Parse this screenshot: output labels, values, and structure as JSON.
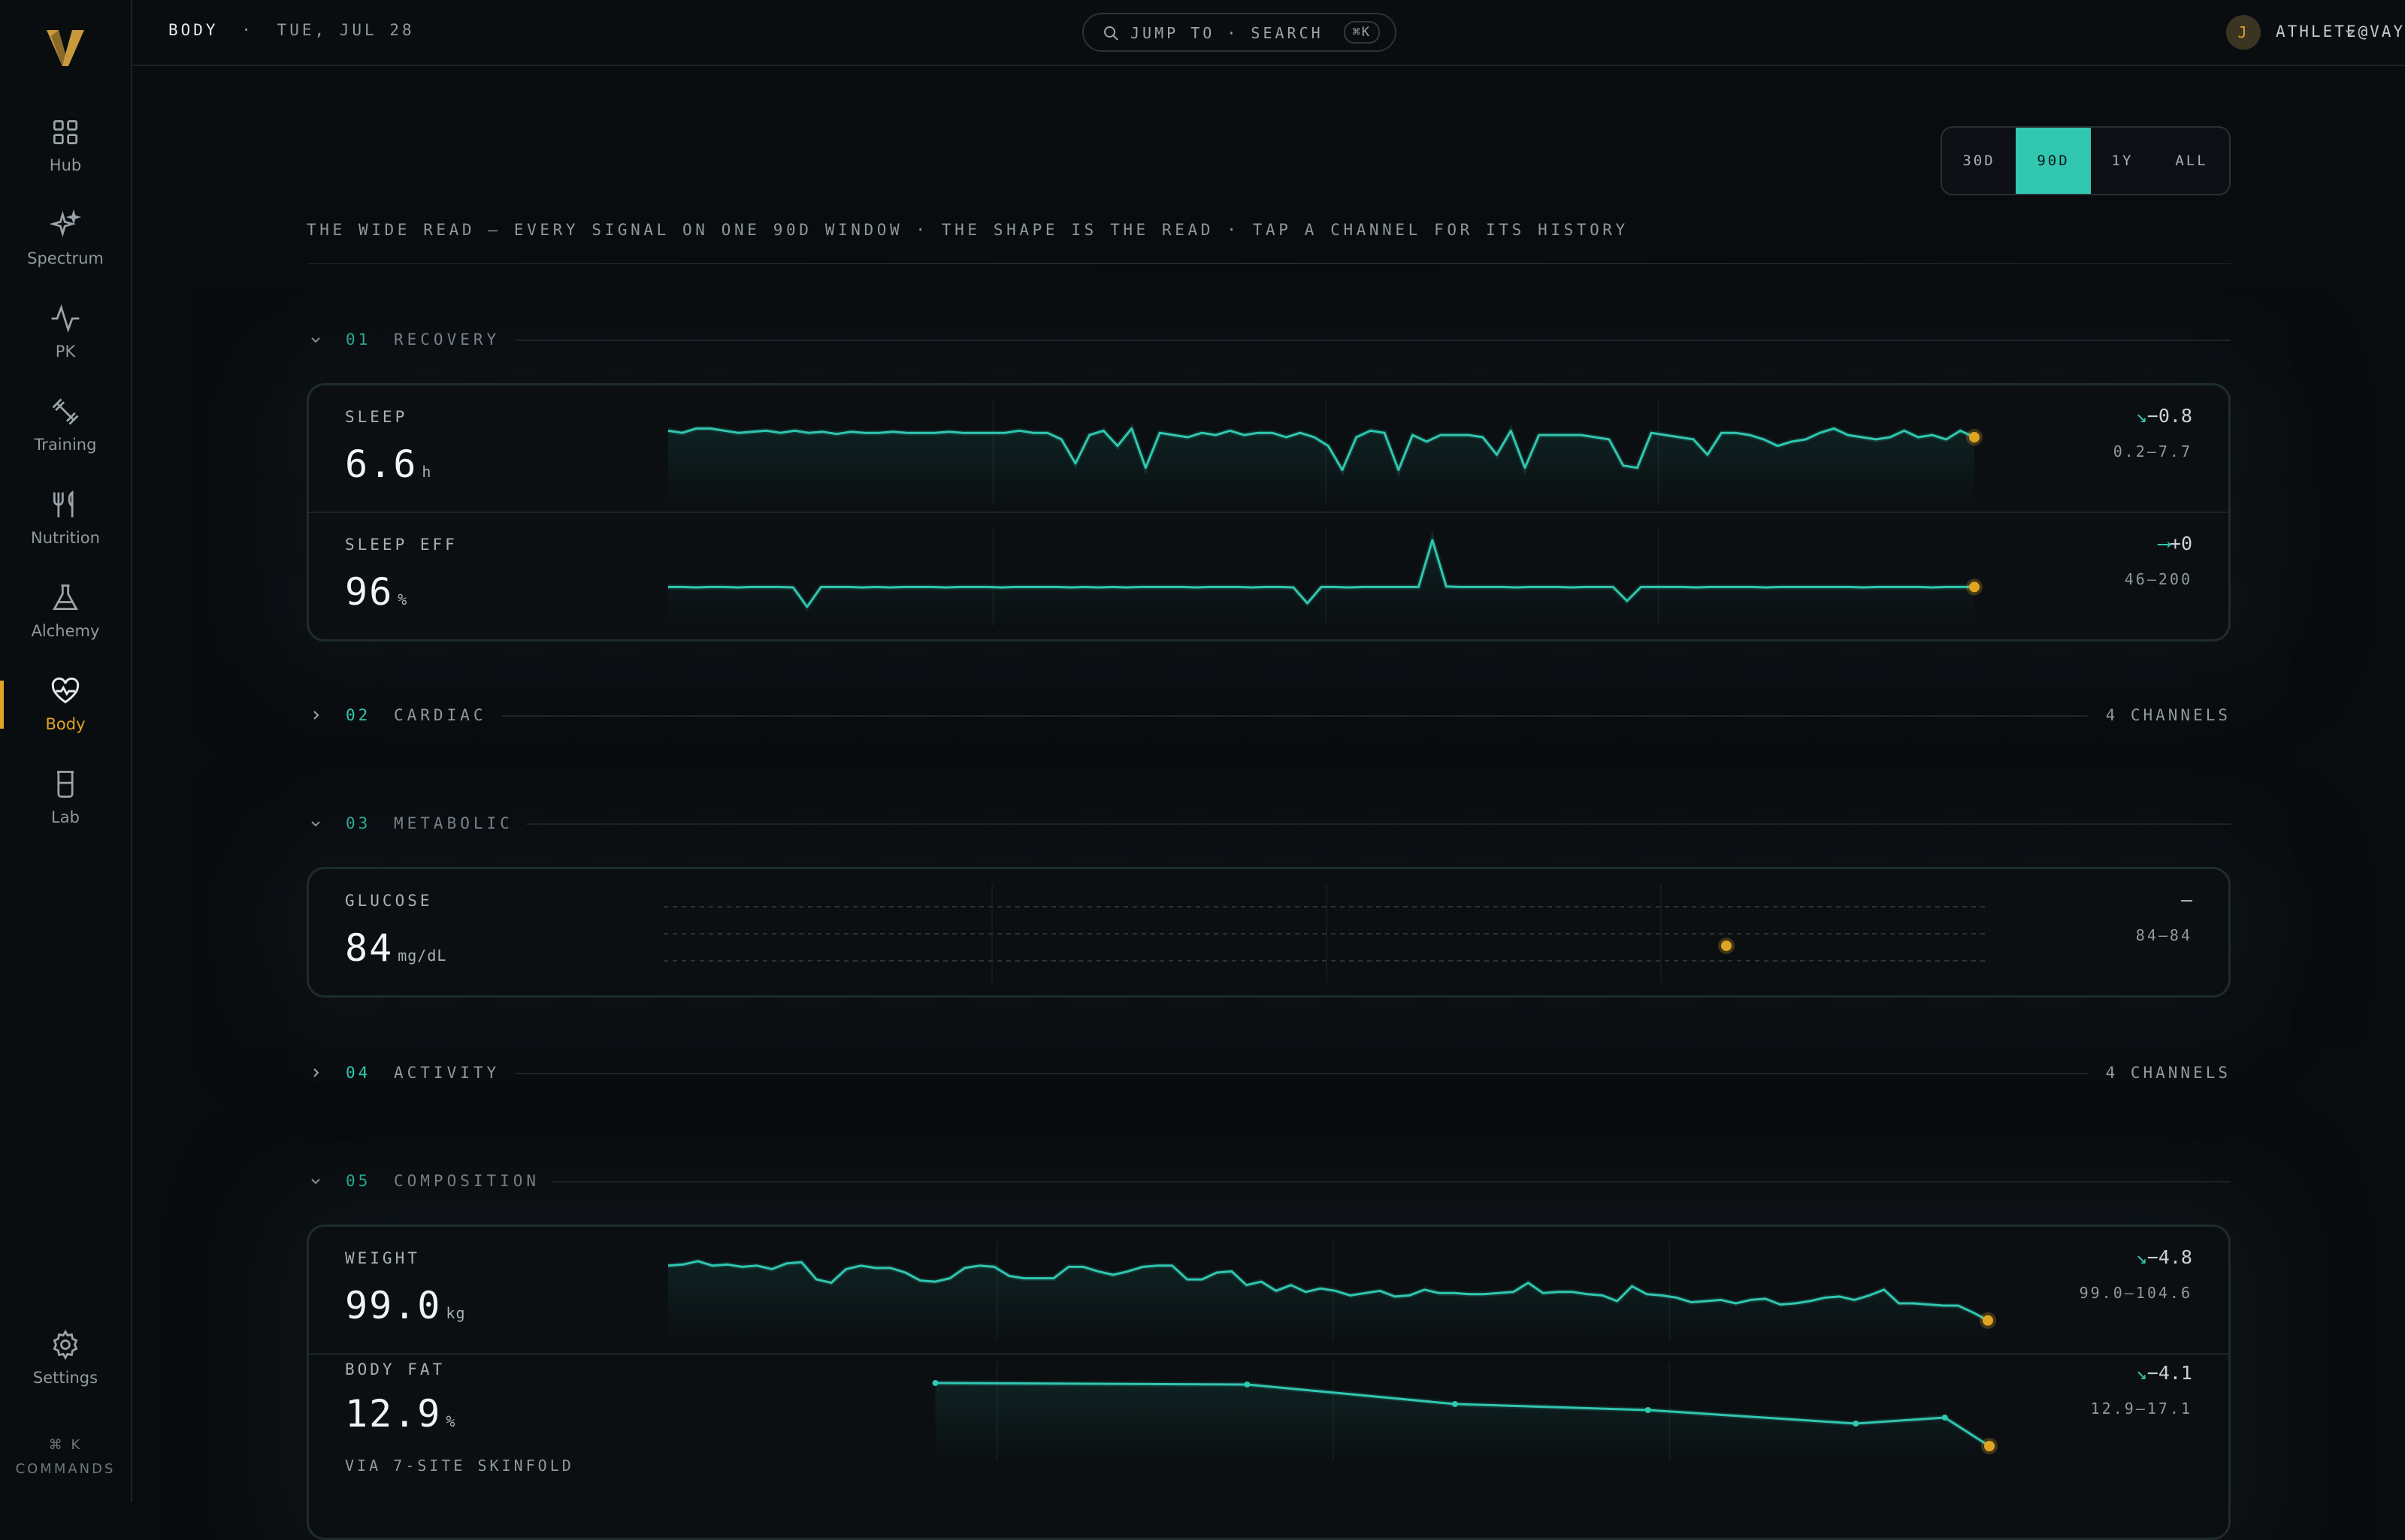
{
  "sidebar": {
    "logo": "V",
    "items": [
      {
        "label": "Hub",
        "icon": "grid-icon"
      },
      {
        "label": "Spectrum",
        "icon": "sparkle-icon"
      },
      {
        "label": "PK",
        "icon": "pulse-icon"
      },
      {
        "label": "Training",
        "icon": "dumbbell-icon"
      },
      {
        "label": "Nutrition",
        "icon": "utensils-icon"
      },
      {
        "label": "Alchemy",
        "icon": "flask-icon"
      },
      {
        "label": "Body",
        "icon": "heart-pulse-icon",
        "active": true
      },
      {
        "label": "Lab",
        "icon": "beaker-icon"
      }
    ],
    "settings_label": "Settings",
    "commands_shortcut": "⌘ K",
    "commands_label": "COMMANDS"
  },
  "topbar": {
    "section": "BODY",
    "separator": "·",
    "date": "TUE, JUL 28",
    "search_label": "JUMP TO · SEARCH",
    "search_shortcut": "⌘K",
    "user_initial": "J",
    "user_email": "ATHLETE@VAYL.PRO"
  },
  "range": {
    "options": [
      "30D",
      "90D",
      "1Y",
      "ALL"
    ],
    "selected": "90D"
  },
  "subtitle": "THE WIDE READ — EVERY SIGNAL ON ONE 90D WINDOW · THE SHAPE IS THE READ · TAP A CHANNEL FOR ITS HISTORY",
  "colors": {
    "accent": "#31c7b0",
    "marker": "#e0a424",
    "bg": "#090c0f"
  },
  "sections": [
    {
      "num": "01",
      "name": "RECOVERY",
      "expanded": true
    },
    {
      "num": "02",
      "name": "CARDIAC",
      "expanded": false,
      "channels": "4 CHANNELS"
    },
    {
      "num": "03",
      "name": "METABOLIC",
      "expanded": true
    },
    {
      "num": "04",
      "name": "ACTIVITY",
      "expanded": false,
      "channels": "4 CHANNELS"
    },
    {
      "num": "05",
      "name": "COMPOSITION",
      "expanded": true
    }
  ],
  "metrics": {
    "sleep": {
      "label": "SLEEP",
      "value": "6.6",
      "unit": "h",
      "arrow": "↘",
      "delta": "−0.8",
      "range": "0.2–7.7",
      "series": [
        6.9,
        6.8,
        7.0,
        7.0,
        6.9,
        6.8,
        6.85,
        6.9,
        6.8,
        6.9,
        6.8,
        6.85,
        6.75,
        6.85,
        6.8,
        6.8,
        6.85,
        6.8,
        6.8,
        6.8,
        6.85,
        6.8,
        6.8,
        6.8,
        6.8,
        6.9,
        6.8,
        6.8,
        6.5,
        5.4,
        6.7,
        6.9,
        6.2,
        7.0,
        5.2,
        6.8,
        6.7,
        6.6,
        6.8,
        6.7,
        6.9,
        6.7,
        6.8,
        6.8,
        6.6,
        6.8,
        6.6,
        6.2,
        5.1,
        6.6,
        6.9,
        6.8,
        5.1,
        6.7,
        6.4,
        6.7,
        6.7,
        6.7,
        6.6,
        5.8,
        6.9,
        5.2,
        6.7,
        6.7,
        6.7,
        6.7,
        6.6,
        6.5,
        5.3,
        5.2,
        6.8,
        6.7,
        6.6,
        6.5,
        5.8,
        6.8,
        6.8,
        6.7,
        6.5,
        6.2,
        6.4,
        6.5,
        6.8,
        7.0,
        6.7,
        6.6,
        6.5,
        6.6,
        6.9,
        6.6,
        6.7,
        6.5,
        6.9,
        6.6
      ]
    },
    "sleep_eff": {
      "label": "SLEEP EFF",
      "value": "96",
      "unit": "%",
      "arrow": "⟶",
      "delta": "+0",
      "range": "46–200",
      "series": [
        96,
        96,
        95,
        96,
        96,
        95,
        96,
        96,
        96,
        95,
        52,
        96,
        96,
        96,
        95,
        96,
        95,
        96,
        96,
        96,
        95,
        96,
        96,
        96,
        95,
        96,
        96,
        96,
        96,
        95,
        96,
        95,
        96,
        95,
        96,
        96,
        96,
        96,
        95,
        96,
        96,
        96,
        95,
        96,
        96,
        95,
        60,
        96,
        96,
        95,
        96,
        96,
        96,
        96,
        96,
        200,
        97,
        96,
        96,
        96,
        96,
        95,
        96,
        96,
        96,
        95,
        96,
        96,
        96,
        65,
        96,
        96,
        96,
        96,
        95,
        96,
        96,
        96,
        96,
        95,
        96,
        96,
        96,
        96,
        96,
        96,
        95,
        96,
        96,
        96,
        96,
        95,
        96,
        96,
        96
      ]
    },
    "glucose": {
      "label": "GLUCOSE",
      "value": "84",
      "unit": "mg/dL",
      "arrow": "",
      "delta": "—",
      "range": "84–84",
      "point": 84
    },
    "weight": {
      "label": "WEIGHT",
      "value": "99.0",
      "unit": "kg",
      "arrow": "↘",
      "delta": "−4.8",
      "range": "99.0–104.6",
      "series": [
        103.8,
        103.9,
        104.2,
        103.8,
        103.9,
        103.7,
        103.8,
        103.5,
        104.0,
        104.1,
        102.6,
        102.3,
        103.5,
        103.8,
        103.6,
        103.6,
        103.2,
        102.5,
        102.4,
        102.7,
        103.6,
        103.8,
        103.7,
        102.9,
        102.7,
        102.7,
        102.7,
        103.7,
        103.7,
        103.3,
        103.0,
        103.3,
        103.7,
        103.8,
        103.8,
        102.6,
        102.6,
        103.2,
        103.3,
        102.1,
        102.4,
        101.6,
        102.1,
        101.5,
        101.8,
        101.6,
        101.2,
        101.4,
        101.6,
        101.1,
        101.2,
        101.7,
        101.4,
        101.4,
        101.3,
        101.3,
        101.4,
        101.5,
        102.3,
        101.4,
        101.5,
        101.5,
        101.3,
        101.2,
        100.7,
        102.0,
        101.3,
        101.2,
        101.0,
        100.6,
        100.7,
        100.8,
        100.5,
        100.8,
        100.9,
        100.4,
        100.5,
        100.7,
        101.0,
        101.1,
        100.8,
        101.2,
        101.7,
        100.5,
        100.5,
        100.4,
        100.3,
        100.3,
        99.7,
        99.0
      ]
    },
    "body_fat": {
      "label": "BODY FAT",
      "value": "12.9",
      "unit": "%",
      "note": "VIA 7-SITE SKINFOLD",
      "arrow": "↘",
      "delta": "−4.1",
      "range": "12.9–17.1",
      "series": [
        {
          "x": 18,
          "y": 17.1
        },
        {
          "x": 39,
          "y": 17.0
        },
        {
          "x": 53,
          "y": 15.7
        },
        {
          "x": 66,
          "y": 15.3
        },
        {
          "x": 80,
          "y": 14.4
        },
        {
          "x": 86,
          "y": 14.8
        },
        {
          "x": 89,
          "y": 12.9
        }
      ]
    }
  }
}
